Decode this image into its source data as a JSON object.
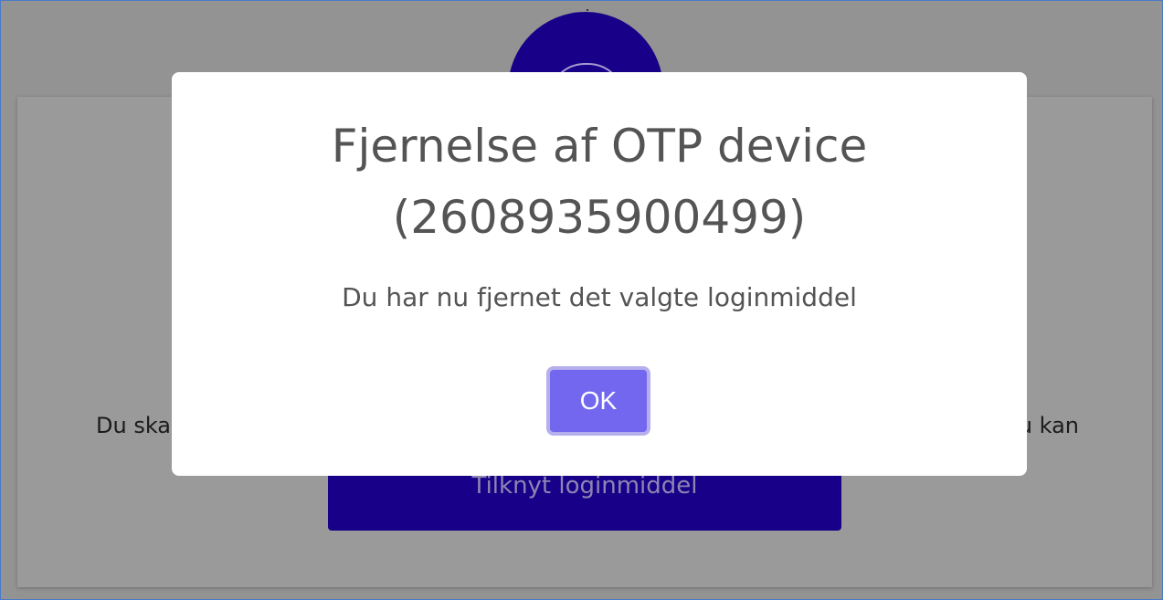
{
  "background": {
    "left_text": "Du skal",
    "right_text": "u kan",
    "connect_button_label": "Tilknyt loginmiddel"
  },
  "dialog": {
    "title_line1": "Fjernelse af OTP device",
    "title_line2": "(2608935900499)",
    "message": "Du har nu fjernet det valgte loginmiddel",
    "ok_label": "OK"
  },
  "colors": {
    "overlay": "#939393",
    "brand_navy": "#190088",
    "ok_button": "#7367f0",
    "ok_button_focus_ring": "#b5afed",
    "dialog_text": "#545454"
  },
  "icons": {
    "logo": "shield-logo-icon"
  }
}
